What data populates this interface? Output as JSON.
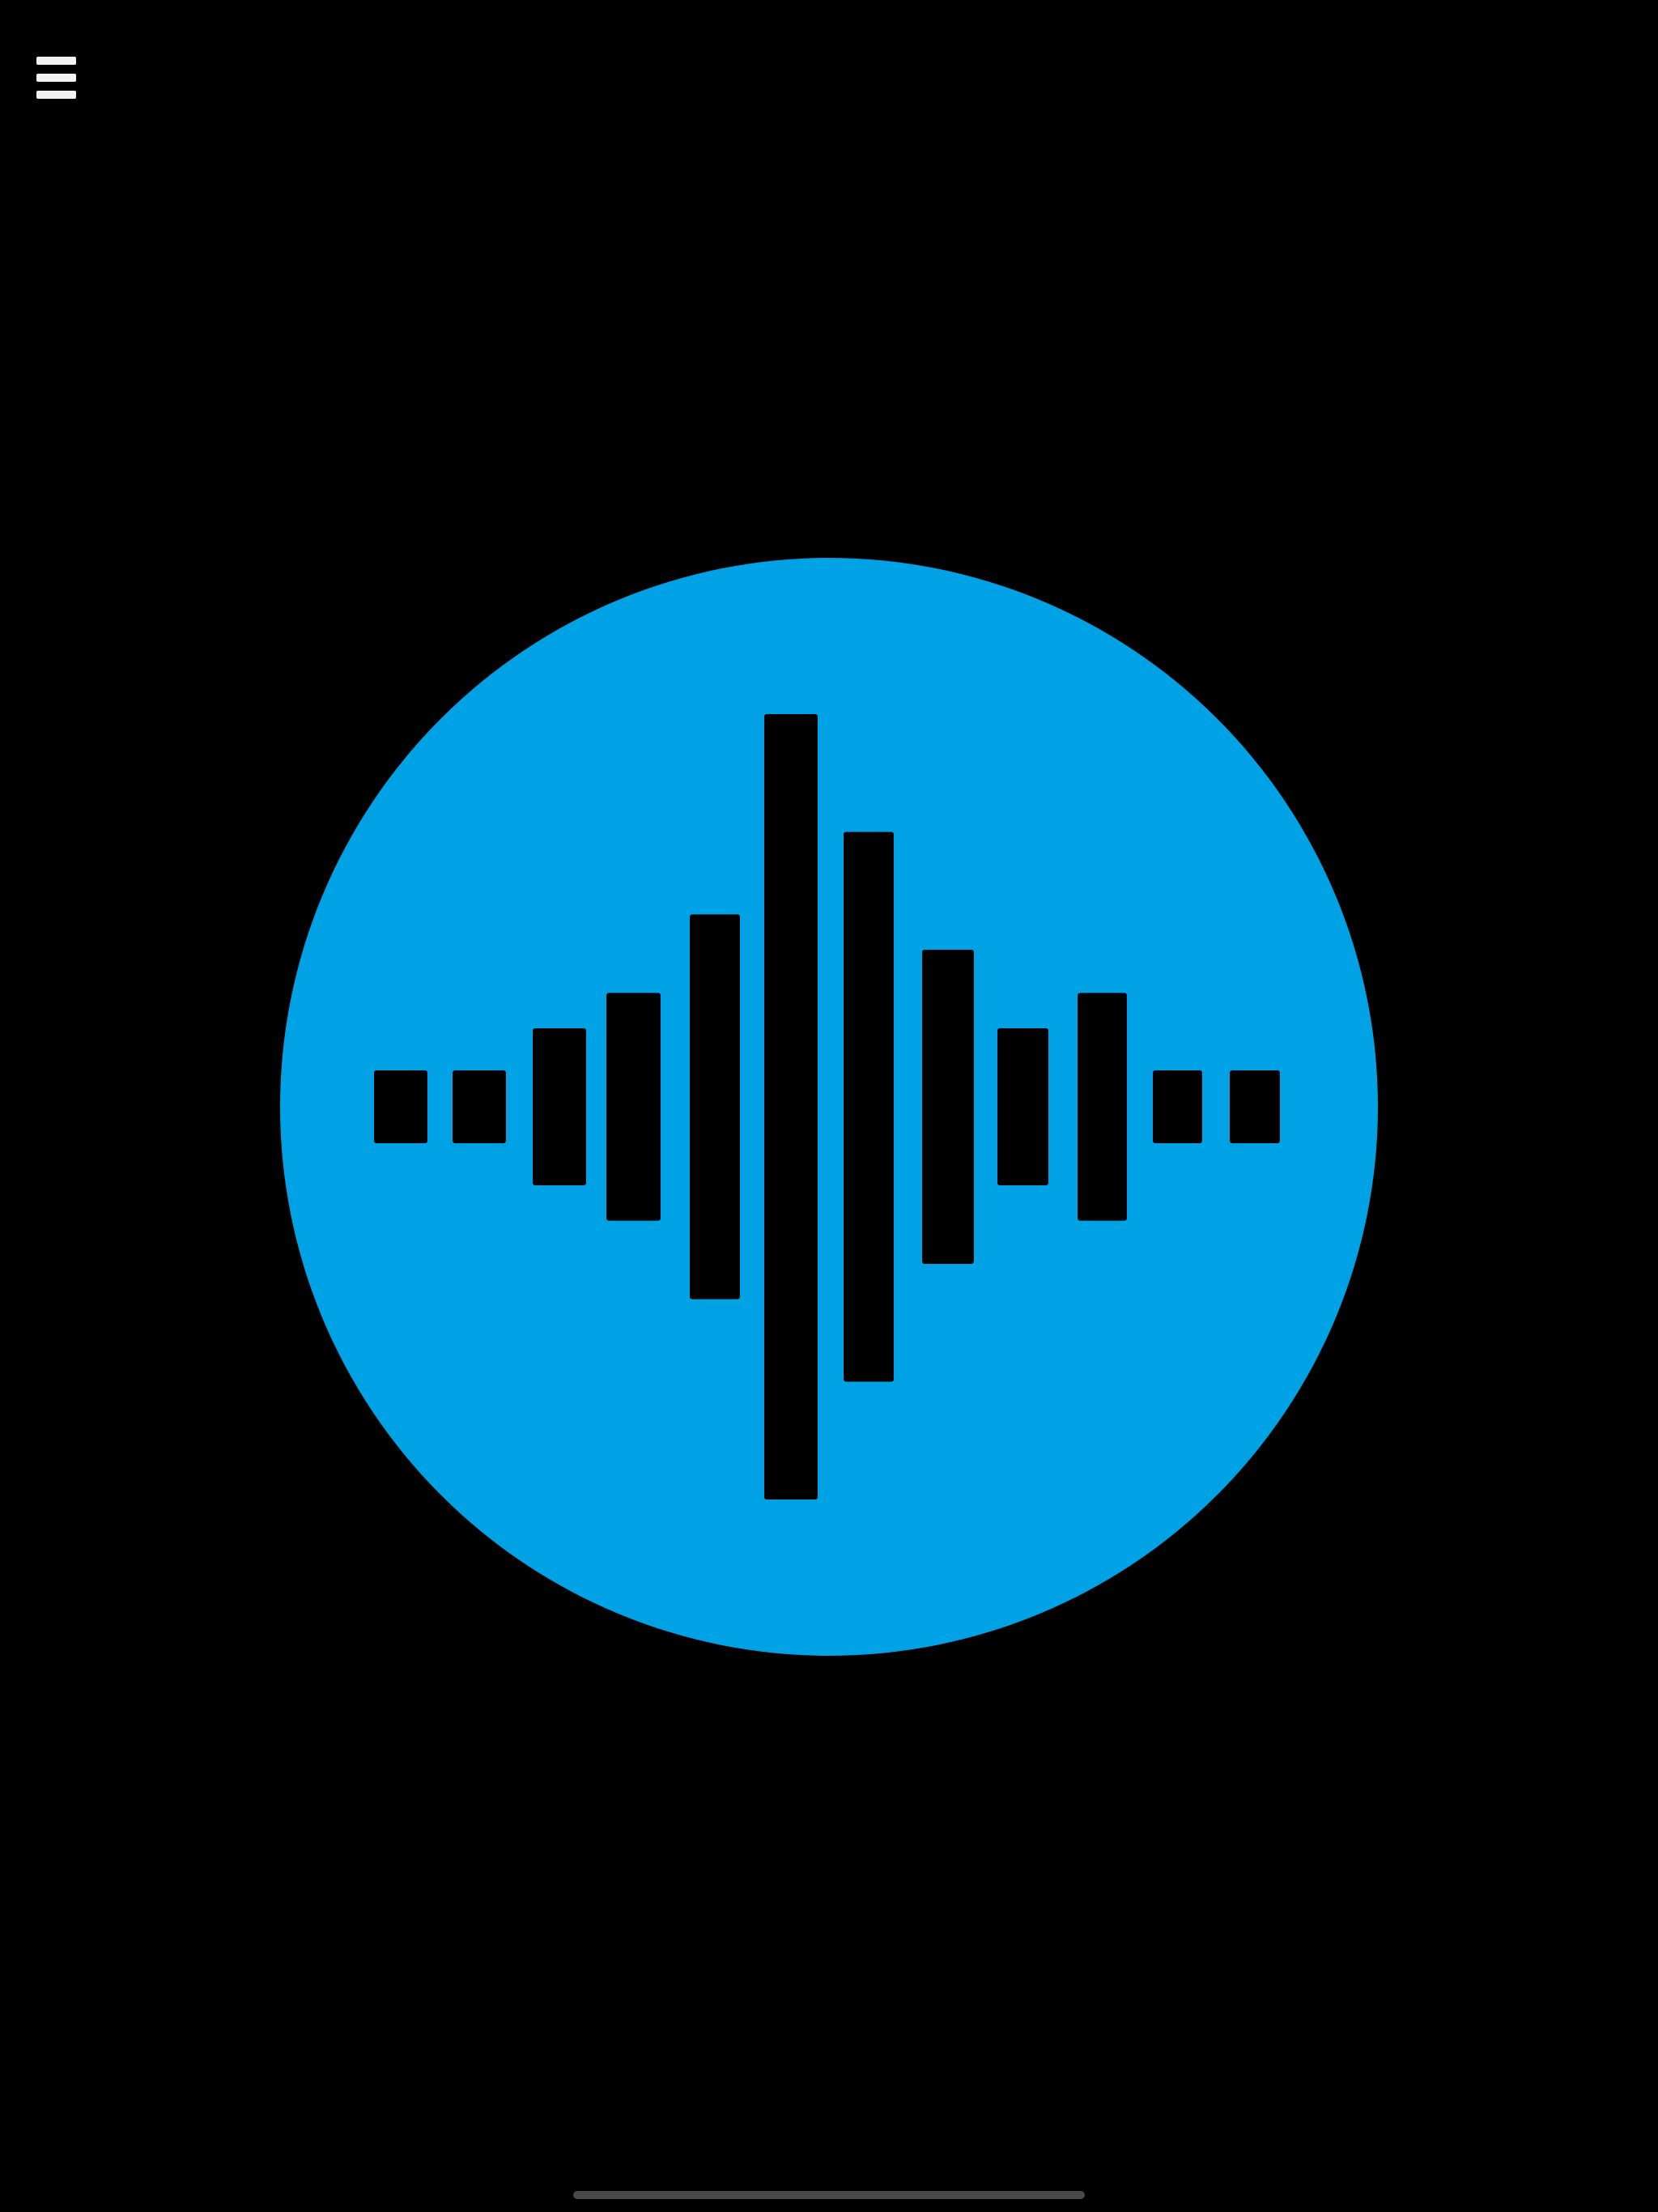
{
  "app": {
    "background_color": "#000000"
  },
  "menu": {
    "icon": "hamburger-menu-icon",
    "icon_color": "#f2f2f2"
  },
  "record_button": {
    "icon": "audio-waveform-icon",
    "circle_color": "#00a2e6",
    "bar_color": "#000000",
    "waveform_levels": [
      0.09,
      0.09,
      0.2,
      0.29,
      0.49,
      1.0,
      0.7,
      0.4,
      0.2,
      0.29,
      0.09,
      0.09
    ]
  },
  "home_indicator": {
    "color": "#4a4a4a"
  }
}
